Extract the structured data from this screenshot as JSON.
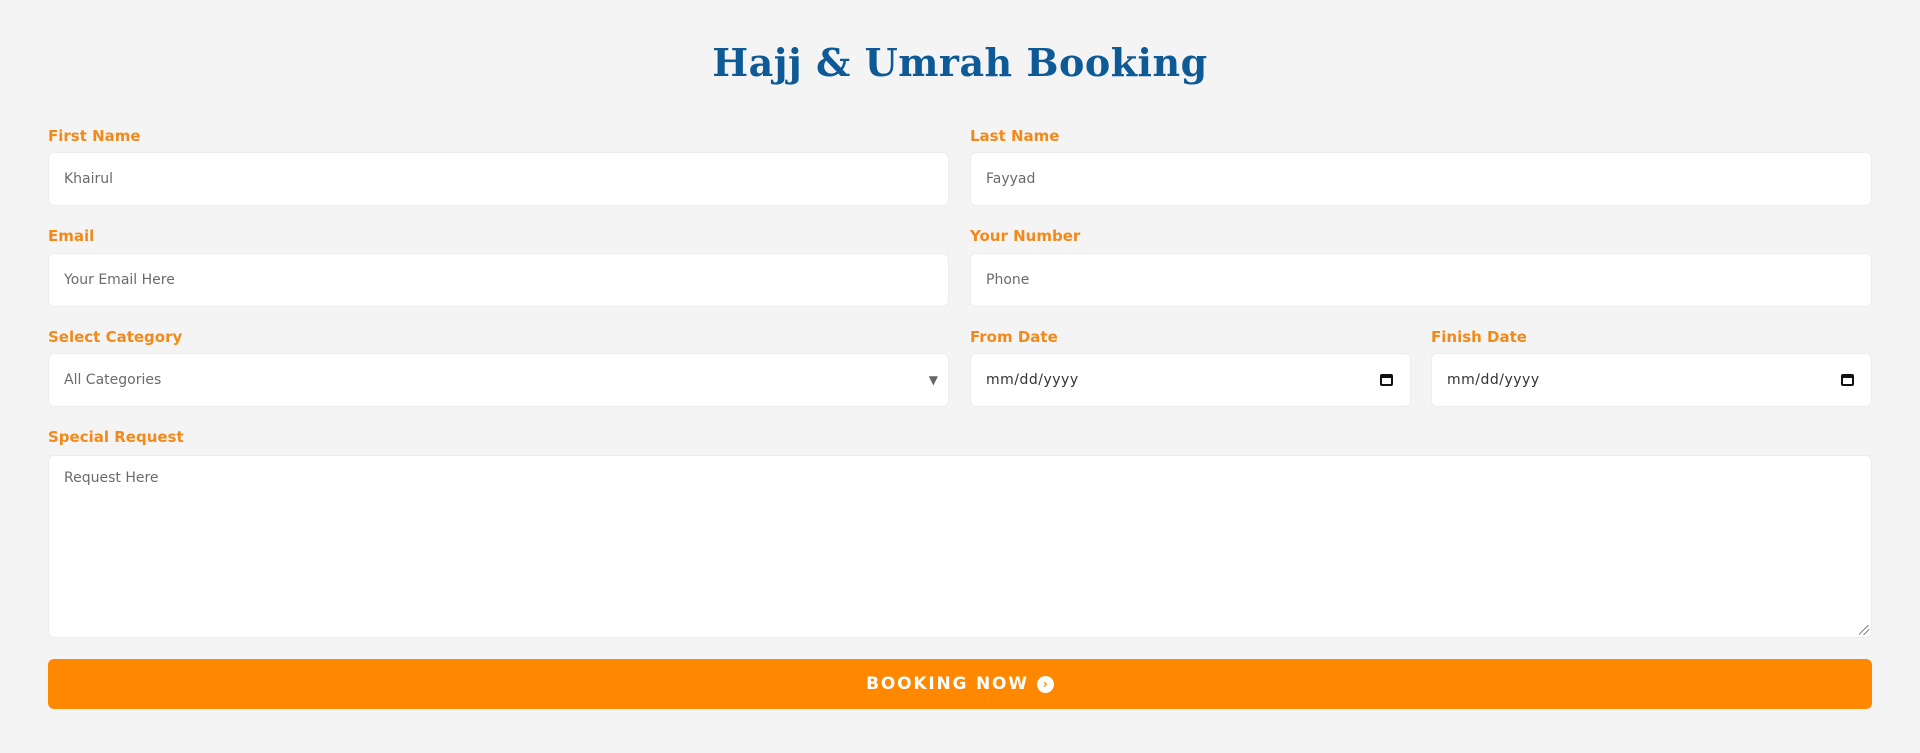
{
  "form": {
    "title": "Hajj & Umrah Booking",
    "first_name": {
      "label": "First Name",
      "value": "Khairul"
    },
    "last_name": {
      "label": "Last Name",
      "value": "Fayyad"
    },
    "email": {
      "label": "Email",
      "placeholder": "Your Email Here"
    },
    "number": {
      "label": "Your Number",
      "placeholder": "Phone"
    },
    "category": {
      "label": "Select Category",
      "selected": "All Categories"
    },
    "from_date": {
      "label": "From Date",
      "placeholder": "mm/dd/yyyy"
    },
    "finish_date": {
      "label": "Finish Date",
      "placeholder": "mm/dd/yyyy"
    },
    "special_request": {
      "label": "Special Request",
      "placeholder": "Request Here"
    },
    "submit": {
      "label": "BOOKING NOW",
      "icon": "chevron-right-circle-icon"
    }
  },
  "colors": {
    "background": "#f4f4f4",
    "title": "#0d5a96",
    "label": "#f28a1b",
    "button": "#ff8800"
  }
}
